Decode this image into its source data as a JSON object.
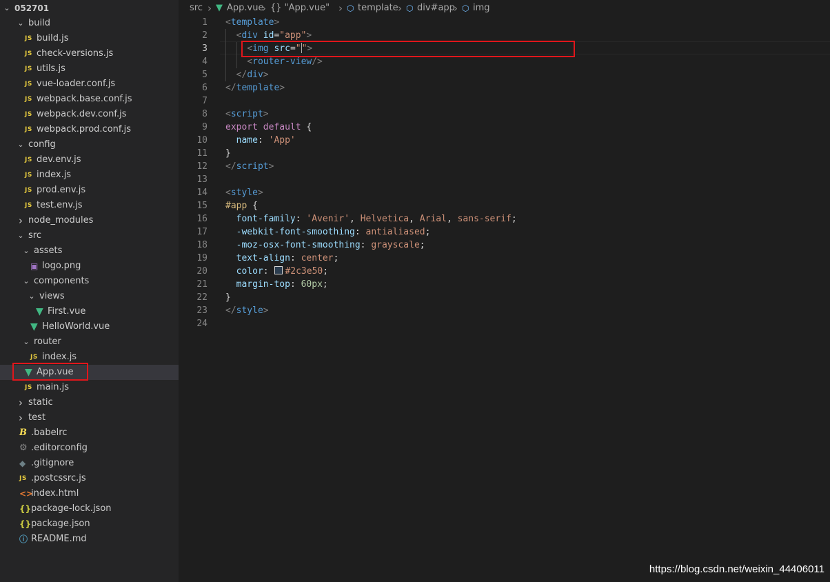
{
  "explorer": {
    "root": "052701",
    "items": [
      {
        "label": "build",
        "kind": "folder",
        "open": true
      },
      {
        "label": "build.js",
        "kind": "js"
      },
      {
        "label": "check-versions.js",
        "kind": "js"
      },
      {
        "label": "utils.js",
        "kind": "js"
      },
      {
        "label": "vue-loader.conf.js",
        "kind": "js"
      },
      {
        "label": "webpack.base.conf.js",
        "kind": "js"
      },
      {
        "label": "webpack.dev.conf.js",
        "kind": "js"
      },
      {
        "label": "webpack.prod.conf.js",
        "kind": "js"
      },
      {
        "label": "config",
        "kind": "folder",
        "open": true
      },
      {
        "label": "dev.env.js",
        "kind": "js"
      },
      {
        "label": "index.js",
        "kind": "js"
      },
      {
        "label": "prod.env.js",
        "kind": "js"
      },
      {
        "label": "test.env.js",
        "kind": "js"
      },
      {
        "label": "node_modules",
        "kind": "folder",
        "open": false
      },
      {
        "label": "src",
        "kind": "folder",
        "open": true
      },
      {
        "label": "assets",
        "kind": "folder",
        "open": true
      },
      {
        "label": "logo.png",
        "kind": "image"
      },
      {
        "label": "components",
        "kind": "folder",
        "open": true
      },
      {
        "label": "views",
        "kind": "folder",
        "open": true
      },
      {
        "label": "First.vue",
        "kind": "vue"
      },
      {
        "label": "HelloWorld.vue",
        "kind": "vue"
      },
      {
        "label": "router",
        "kind": "folder",
        "open": true
      },
      {
        "label": "index.js",
        "kind": "js"
      },
      {
        "label": "App.vue",
        "kind": "vue",
        "selected": true
      },
      {
        "label": "main.js",
        "kind": "js"
      },
      {
        "label": "static",
        "kind": "folder",
        "open": false
      },
      {
        "label": "test",
        "kind": "folder",
        "open": false
      },
      {
        "label": ".babelrc",
        "kind": "babel"
      },
      {
        "label": ".editorconfig",
        "kind": "gear"
      },
      {
        "label": ".gitignore",
        "kind": "git"
      },
      {
        "label": ".postcssrc.js",
        "kind": "js"
      },
      {
        "label": "index.html",
        "kind": "html"
      },
      {
        "label": "package-lock.json",
        "kind": "json"
      },
      {
        "label": "package.json",
        "kind": "json"
      },
      {
        "label": "README.md",
        "kind": "info"
      }
    ]
  },
  "icons": {
    "chevron_down": "⌄",
    "chevron_right": "›",
    "js": "JS",
    "vue": "▼",
    "image": "▣",
    "json": "{}",
    "html": "<>",
    "gear": "⚙",
    "git": "◆",
    "babel": "B",
    "info": "ⓘ"
  },
  "breadcrumb": {
    "items": [
      "src",
      "App.vue",
      "{} \"App.vue\"",
      "template",
      "div#app",
      "img"
    ]
  },
  "editor": {
    "active_line": 3,
    "lines": [
      [
        [
          "t-brk",
          "<"
        ],
        [
          "t-tag",
          "template"
        ],
        [
          "t-brk",
          ">"
        ]
      ],
      [
        [
          "t-plain",
          "  "
        ],
        [
          "t-brk",
          "<"
        ],
        [
          "t-tag",
          "div"
        ],
        [
          "t-plain",
          " "
        ],
        [
          "t-attr",
          "id"
        ],
        [
          "t-plain",
          "="
        ],
        [
          "t-str",
          "\"app\""
        ],
        [
          "t-brk",
          ">"
        ]
      ],
      [
        [
          "t-plain",
          "    "
        ],
        [
          "t-brk",
          "<"
        ],
        [
          "t-tag",
          "img"
        ],
        [
          "t-plain",
          " "
        ],
        [
          "t-attr",
          "src"
        ],
        [
          "t-plain",
          "="
        ],
        [
          "t-str",
          "\"\""
        ],
        [
          "t-brk",
          ">"
        ]
      ],
      [
        [
          "t-plain",
          "    "
        ],
        [
          "t-brk",
          "<"
        ],
        [
          "t-tag",
          "router-view"
        ],
        [
          "t-brk",
          "/>"
        ]
      ],
      [
        [
          "t-plain",
          "  "
        ],
        [
          "t-brk",
          "</"
        ],
        [
          "t-tag",
          "div"
        ],
        [
          "t-brk",
          ">"
        ]
      ],
      [
        [
          "t-brk",
          "</"
        ],
        [
          "t-tag",
          "template"
        ],
        [
          "t-brk",
          ">"
        ]
      ],
      [],
      [
        [
          "t-brk",
          "<"
        ],
        [
          "t-tag",
          "script"
        ],
        [
          "t-brk",
          ">"
        ]
      ],
      [
        [
          "t-kw",
          "export"
        ],
        [
          "t-plain",
          " "
        ],
        [
          "t-kw",
          "default"
        ],
        [
          "t-plain",
          " {"
        ]
      ],
      [
        [
          "t-plain",
          "  "
        ],
        [
          "t-prop",
          "name"
        ],
        [
          "t-plain",
          ": "
        ],
        [
          "t-str",
          "'App'"
        ]
      ],
      [
        [
          "t-plain",
          "}"
        ]
      ],
      [
        [
          "t-brk",
          "</"
        ],
        [
          "t-tag",
          "script"
        ],
        [
          "t-brk",
          ">"
        ]
      ],
      [],
      [
        [
          "t-brk",
          "<"
        ],
        [
          "t-tag",
          "style"
        ],
        [
          "t-brk",
          ">"
        ]
      ],
      [
        [
          "t-sel",
          "#app"
        ],
        [
          "t-plain",
          " {"
        ]
      ],
      [
        [
          "t-plain",
          "  "
        ],
        [
          "t-prop",
          "font-family"
        ],
        [
          "t-plain",
          ": "
        ],
        [
          "t-val",
          "'Avenir'"
        ],
        [
          "t-plain",
          ", "
        ],
        [
          "t-val",
          "Helvetica"
        ],
        [
          "t-plain",
          ", "
        ],
        [
          "t-val",
          "Arial"
        ],
        [
          "t-plain",
          ", "
        ],
        [
          "t-val",
          "sans-serif"
        ],
        [
          "t-plain",
          ";"
        ]
      ],
      [
        [
          "t-plain",
          "  "
        ],
        [
          "t-prop",
          "-webkit-font-smoothing"
        ],
        [
          "t-plain",
          ": "
        ],
        [
          "t-val",
          "antialiased"
        ],
        [
          "t-plain",
          ";"
        ]
      ],
      [
        [
          "t-plain",
          "  "
        ],
        [
          "t-prop",
          "-moz-osx-font-smoothing"
        ],
        [
          "t-plain",
          ": "
        ],
        [
          "t-val",
          "grayscale"
        ],
        [
          "t-plain",
          ";"
        ]
      ],
      [
        [
          "t-plain",
          "  "
        ],
        [
          "t-prop",
          "text-align"
        ],
        [
          "t-plain",
          ": "
        ],
        [
          "t-val",
          "center"
        ],
        [
          "t-plain",
          ";"
        ]
      ],
      [
        [
          "t-plain",
          "  "
        ],
        [
          "t-prop",
          "color"
        ],
        [
          "t-plain",
          ": "
        ],
        [
          "swatch",
          ""
        ],
        [
          "t-val",
          "#2c3e50"
        ],
        [
          "t-plain",
          ";"
        ]
      ],
      [
        [
          "t-plain",
          "  "
        ],
        [
          "t-prop",
          "margin-top"
        ],
        [
          "t-plain",
          ": "
        ],
        [
          "t-num",
          "60px"
        ],
        [
          "t-plain",
          ";"
        ]
      ],
      [
        [
          "t-plain",
          "}"
        ]
      ],
      [
        [
          "t-brk",
          "</"
        ],
        [
          "t-tag",
          "style"
        ],
        [
          "t-brk",
          ">"
        ]
      ],
      []
    ]
  },
  "watermark": "https://blog.csdn.net/weixin_44406011",
  "colors": {
    "highlight": "#e0161b",
    "swatch": "#2c3e50"
  }
}
